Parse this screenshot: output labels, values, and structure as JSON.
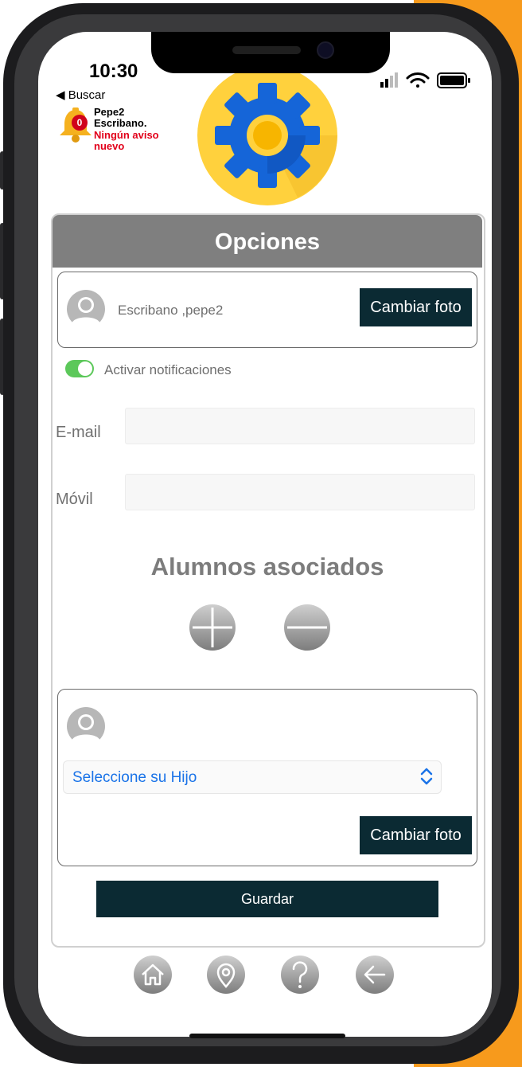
{
  "status": {
    "time": "10:30",
    "back_label": "◀ Buscar"
  },
  "notification": {
    "badge_count": "0",
    "user_name_line1": "Pepe2",
    "user_name_line2": "Escribano.",
    "message": "Ningún aviso nuevo"
  },
  "header": {
    "title": "Opciones"
  },
  "profile": {
    "name": "Escribano ,pepe2",
    "change_photo_label": "Cambiar foto"
  },
  "notifications_toggle": {
    "label": "Activar notificaciones",
    "enabled": true
  },
  "fields": {
    "email_label": "E-mail",
    "email_value": "",
    "mobile_label": "Móvil",
    "mobile_value": ""
  },
  "students": {
    "section_title": "Alumnos asociados",
    "select_placeholder": "Seleccione su Hijo",
    "change_photo_label": "Cambiar foto"
  },
  "actions": {
    "save_label": "Guardar"
  },
  "bottom_nav": {
    "items": [
      "home-icon",
      "location-pin-icon",
      "help-icon",
      "back-arrow-icon"
    ]
  },
  "colors": {
    "accent_dark": "#0b2a33",
    "header_gray": "#7f7f7f",
    "toggle_green": "#5cc85a",
    "badge_red": "#d0021b",
    "notice_red": "#e2001a",
    "select_blue": "#1a73e8",
    "gear_blue": "#1565d8",
    "gear_yellow": "#ffd13d"
  }
}
